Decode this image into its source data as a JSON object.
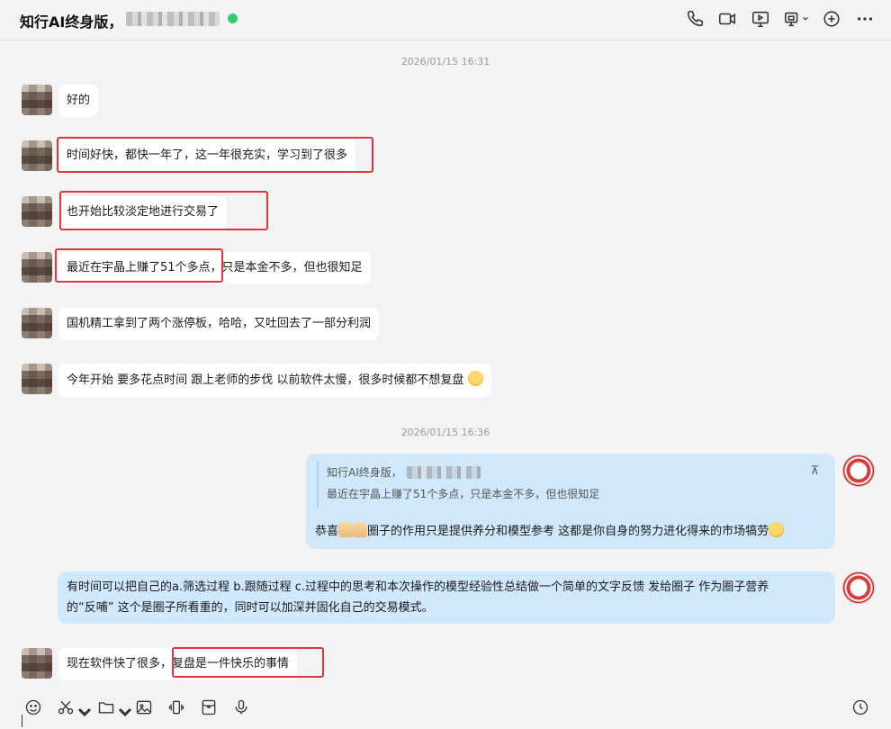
{
  "header": {
    "title": "知行AI终身版，",
    "icons": [
      "phone-icon",
      "video-call-icon",
      "screen-share-icon",
      "remote-desktop-icon",
      "add-member-icon",
      "more-icon"
    ]
  },
  "timestamps": [
    "2026/01/15 16:31",
    "2026/01/15 16:36"
  ],
  "messages": [
    {
      "text": "好的"
    },
    {
      "text": "时间好快，都快一年了，这一年很充实，学习到了很多"
    },
    {
      "text": "也开始比较淡定地进行交易了"
    },
    {
      "highlight": "最近在宇晶上赚了51个多点",
      "rest": "，只是本金不多，但也很知足"
    },
    {
      "text": "国机精工拿到了两个涨停板，哈哈，又吐回去了一部分利润"
    },
    {
      "text": "今年开始 要多花点时间 跟上老师的步伐 以前软件太慢，很多时候都不想复盘"
    },
    {
      "quote_name": "知行AI终身版，",
      "quote_text": "最近在宇晶上赚了51个多点，只是本金不多，但也很知足",
      "quote_toggle": "⊼",
      "prefix": "恭喜",
      "text": "圈子的作用只是提供养分和模型参考 这都是你自身的努力进化得来的市场犒劳"
    },
    {
      "line1": "有时间可以把自己的a.筛选过程 b.跟随过程 c.过程中的思考和本次操作的模型经验性总结做一个简单的文字反馈 发给圈子 作为圈子营养",
      "line2": "的“反哺” 这个是圈子所看重的，同时可以加深并固化自己的交易模式。"
    },
    {
      "prefix": "现在软件快了很多，",
      "highlight": "复盘是一件快乐的事情"
    }
  ],
  "toolbar": {
    "icons": [
      "emoji-icon",
      "scissors-icon",
      "folder-icon",
      "image-icon",
      "shake-icon",
      "red-packet-icon",
      "microphone-icon",
      "history-icon"
    ]
  },
  "colors": {
    "accent_red": "#e0353c",
    "bubble_blue": "#cfe8fb",
    "online_green": "#2fce6a"
  }
}
